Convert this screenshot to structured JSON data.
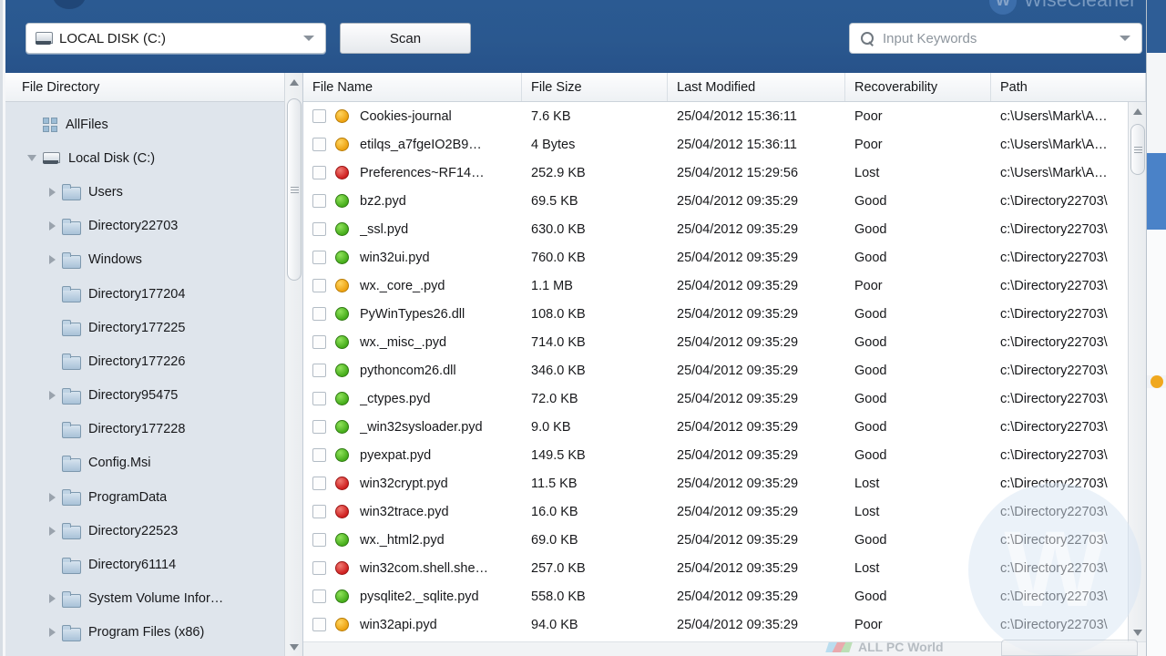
{
  "app": {
    "brand": "WiseCleaner",
    "brand_mark": "W"
  },
  "toolbar": {
    "disk_label": "LOCAL DISK (C:)",
    "disk_icon": "hard-disk-icon",
    "scan_label": "Scan",
    "search_placeholder": "Input Keywords",
    "search_icon": "search-icon",
    "dropdown_icon": "chevron-down-icon"
  },
  "sidebar": {
    "header": "File Directory",
    "items": [
      {
        "label": "AllFiles",
        "icon": "grid-icon",
        "indent": 1,
        "twisty": "none"
      },
      {
        "label": "Local Disk (C:)",
        "icon": "disk-icon",
        "indent": 1,
        "twisty": "down"
      },
      {
        "label": "Users",
        "icon": "folder-icon",
        "indent": 2,
        "twisty": "right"
      },
      {
        "label": "Directory22703",
        "icon": "folder-icon",
        "indent": 2,
        "twisty": "right"
      },
      {
        "label": "Windows",
        "icon": "folder-icon",
        "indent": 2,
        "twisty": "right"
      },
      {
        "label": "Directory177204",
        "icon": "folder-icon",
        "indent": 2,
        "twisty": "none"
      },
      {
        "label": "Directory177225",
        "icon": "folder-icon",
        "indent": 2,
        "twisty": "none"
      },
      {
        "label": "Directory177226",
        "icon": "folder-icon",
        "indent": 2,
        "twisty": "none"
      },
      {
        "label": "Directory95475",
        "icon": "folder-icon",
        "indent": 2,
        "twisty": "right"
      },
      {
        "label": "Directory177228",
        "icon": "folder-icon",
        "indent": 2,
        "twisty": "none"
      },
      {
        "label": "Config.Msi",
        "icon": "folder-icon",
        "indent": 2,
        "twisty": "none"
      },
      {
        "label": "ProgramData",
        "icon": "folder-icon",
        "indent": 2,
        "twisty": "right"
      },
      {
        "label": "Directory22523",
        "icon": "folder-icon",
        "indent": 2,
        "twisty": "right"
      },
      {
        "label": "Directory61114",
        "icon": "folder-icon",
        "indent": 2,
        "twisty": "none"
      },
      {
        "label": "System Volume Infor…",
        "icon": "folder-icon",
        "indent": 2,
        "twisty": "right"
      },
      {
        "label": "Program Files (x86)",
        "icon": "folder-icon",
        "indent": 2,
        "twisty": "right"
      }
    ]
  },
  "file_list": {
    "columns": [
      "File Name",
      "File Size",
      "Last Modified",
      "Recoverability",
      "Path"
    ],
    "rows": [
      {
        "name": "Cookies-journal",
        "status": "poor",
        "size": "7.6 KB",
        "modified": "25/04/2012 15:36:11",
        "recoverability": "Poor",
        "path": "c:\\Users\\Mark\\A…"
      },
      {
        "name": "etilqs_a7fgeIO2B9…",
        "status": "poor",
        "size": "4 Bytes",
        "modified": "25/04/2012 15:36:11",
        "recoverability": "Poor",
        "path": "c:\\Users\\Mark\\A…"
      },
      {
        "name": "Preferences~RF14…",
        "status": "lost",
        "size": "252.9 KB",
        "modified": "25/04/2012 15:29:56",
        "recoverability": "Lost",
        "path": "c:\\Users\\Mark\\A…"
      },
      {
        "name": "bz2.pyd",
        "status": "good",
        "size": "69.5 KB",
        "modified": "25/04/2012 09:35:29",
        "recoverability": "Good",
        "path": "c:\\Directory22703\\"
      },
      {
        "name": "_ssl.pyd",
        "status": "good",
        "size": "630.0 KB",
        "modified": "25/04/2012 09:35:29",
        "recoverability": "Good",
        "path": "c:\\Directory22703\\"
      },
      {
        "name": "win32ui.pyd",
        "status": "good",
        "size": "760.0 KB",
        "modified": "25/04/2012 09:35:29",
        "recoverability": "Good",
        "path": "c:\\Directory22703\\"
      },
      {
        "name": "wx._core_.pyd",
        "status": "poor",
        "size": "1.1 MB",
        "modified": "25/04/2012 09:35:29",
        "recoverability": "Poor",
        "path": "c:\\Directory22703\\"
      },
      {
        "name": "PyWinTypes26.dll",
        "status": "good",
        "size": "108.0 KB",
        "modified": "25/04/2012 09:35:29",
        "recoverability": "Good",
        "path": "c:\\Directory22703\\"
      },
      {
        "name": "wx._misc_.pyd",
        "status": "good",
        "size": "714.0 KB",
        "modified": "25/04/2012 09:35:29",
        "recoverability": "Good",
        "path": "c:\\Directory22703\\"
      },
      {
        "name": "pythoncom26.dll",
        "status": "good",
        "size": "346.0 KB",
        "modified": "25/04/2012 09:35:29",
        "recoverability": "Good",
        "path": "c:\\Directory22703\\"
      },
      {
        "name": "_ctypes.pyd",
        "status": "good",
        "size": "72.0 KB",
        "modified": "25/04/2012 09:35:29",
        "recoverability": "Good",
        "path": "c:\\Directory22703\\"
      },
      {
        "name": "_win32sysloader.pyd",
        "status": "good",
        "size": "9.0 KB",
        "modified": "25/04/2012 09:35:29",
        "recoverability": "Good",
        "path": "c:\\Directory22703\\"
      },
      {
        "name": "pyexpat.pyd",
        "status": "good",
        "size": "149.5 KB",
        "modified": "25/04/2012 09:35:29",
        "recoverability": "Good",
        "path": "c:\\Directory22703\\"
      },
      {
        "name": "win32crypt.pyd",
        "status": "lost",
        "size": "11.5 KB",
        "modified": "25/04/2012 09:35:29",
        "recoverability": "Lost",
        "path": "c:\\Directory22703\\"
      },
      {
        "name": "win32trace.pyd",
        "status": "lost",
        "size": "16.0 KB",
        "modified": "25/04/2012 09:35:29",
        "recoverability": "Lost",
        "path": "c:\\Directory22703\\"
      },
      {
        "name": "wx._html2.pyd",
        "status": "good",
        "size": "69.0 KB",
        "modified": "25/04/2012 09:35:29",
        "recoverability": "Good",
        "path": "c:\\Directory22703\\"
      },
      {
        "name": "win32com.shell.she…",
        "status": "lost",
        "size": "257.0 KB",
        "modified": "25/04/2012 09:35:29",
        "recoverability": "Lost",
        "path": "c:\\Directory22703\\"
      },
      {
        "name": "pysqlite2._sqlite.pyd",
        "status": "good",
        "size": "558.0 KB",
        "modified": "25/04/2012 09:35:29",
        "recoverability": "Good",
        "path": "c:\\Directory22703\\"
      },
      {
        "name": "win32api.pyd",
        "status": "poor",
        "size": "94.0 KB",
        "modified": "25/04/2012 09:35:29",
        "recoverability": "Poor",
        "path": "c:\\Directory22703\\"
      }
    ]
  },
  "watermark": {
    "letter": "W",
    "text": "ALL PC World"
  },
  "colors": {
    "toolbar_blue": "#2a588f",
    "status_good": "#46ad1b",
    "status_poor": "#eda211",
    "status_lost": "#cf2020",
    "pane_bg": "#dfe5ec"
  }
}
